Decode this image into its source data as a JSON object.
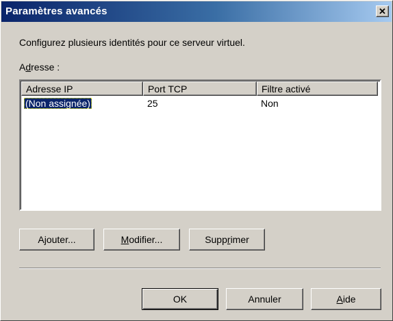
{
  "window": {
    "title": "Paramètres avancés",
    "close_glyph": "✕"
  },
  "description": "Configurez plusieurs identités pour ce serveur virtuel.",
  "address_label": {
    "mnemonic": "d",
    "before": "A",
    "after": "resse :"
  },
  "listview": {
    "columns": [
      "Adresse IP",
      "Port TCP",
      "Filtre activé"
    ],
    "rows": [
      {
        "ip": "(Non assignée)",
        "port": "25",
        "filter": "Non",
        "selected": true
      }
    ]
  },
  "buttons": {
    "add": {
      "before": "A",
      "mnemonic": "j",
      "after": "outer..."
    },
    "modify": {
      "before": "",
      "mnemonic": "M",
      "after": "odifier..."
    },
    "delete": {
      "before": "Supp",
      "mnemonic": "r",
      "after": "imer"
    },
    "ok": "OK",
    "cancel": "Annuler",
    "help": {
      "before": "",
      "mnemonic": "A",
      "after": "ide"
    }
  }
}
